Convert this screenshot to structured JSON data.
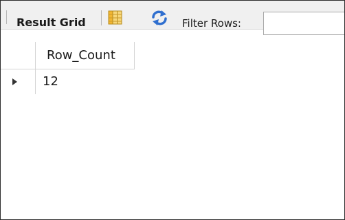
{
  "toolbar": {
    "result_grid_label": "Result Grid",
    "filter_label": "Filter Rows:",
    "filter_value": "",
    "grid_icon": "grid-columns-icon",
    "refresh_icon": "refresh-icon"
  },
  "table": {
    "columns": [
      "Row_Count"
    ],
    "rows": [
      [
        "12"
      ]
    ]
  },
  "colors": {
    "toolbar_bg": "#f0f0f0",
    "grid_icon_accent": "#f2b632",
    "refresh_icon_accent": "#2f6fcf",
    "grid_line": "#d4d4d4"
  }
}
